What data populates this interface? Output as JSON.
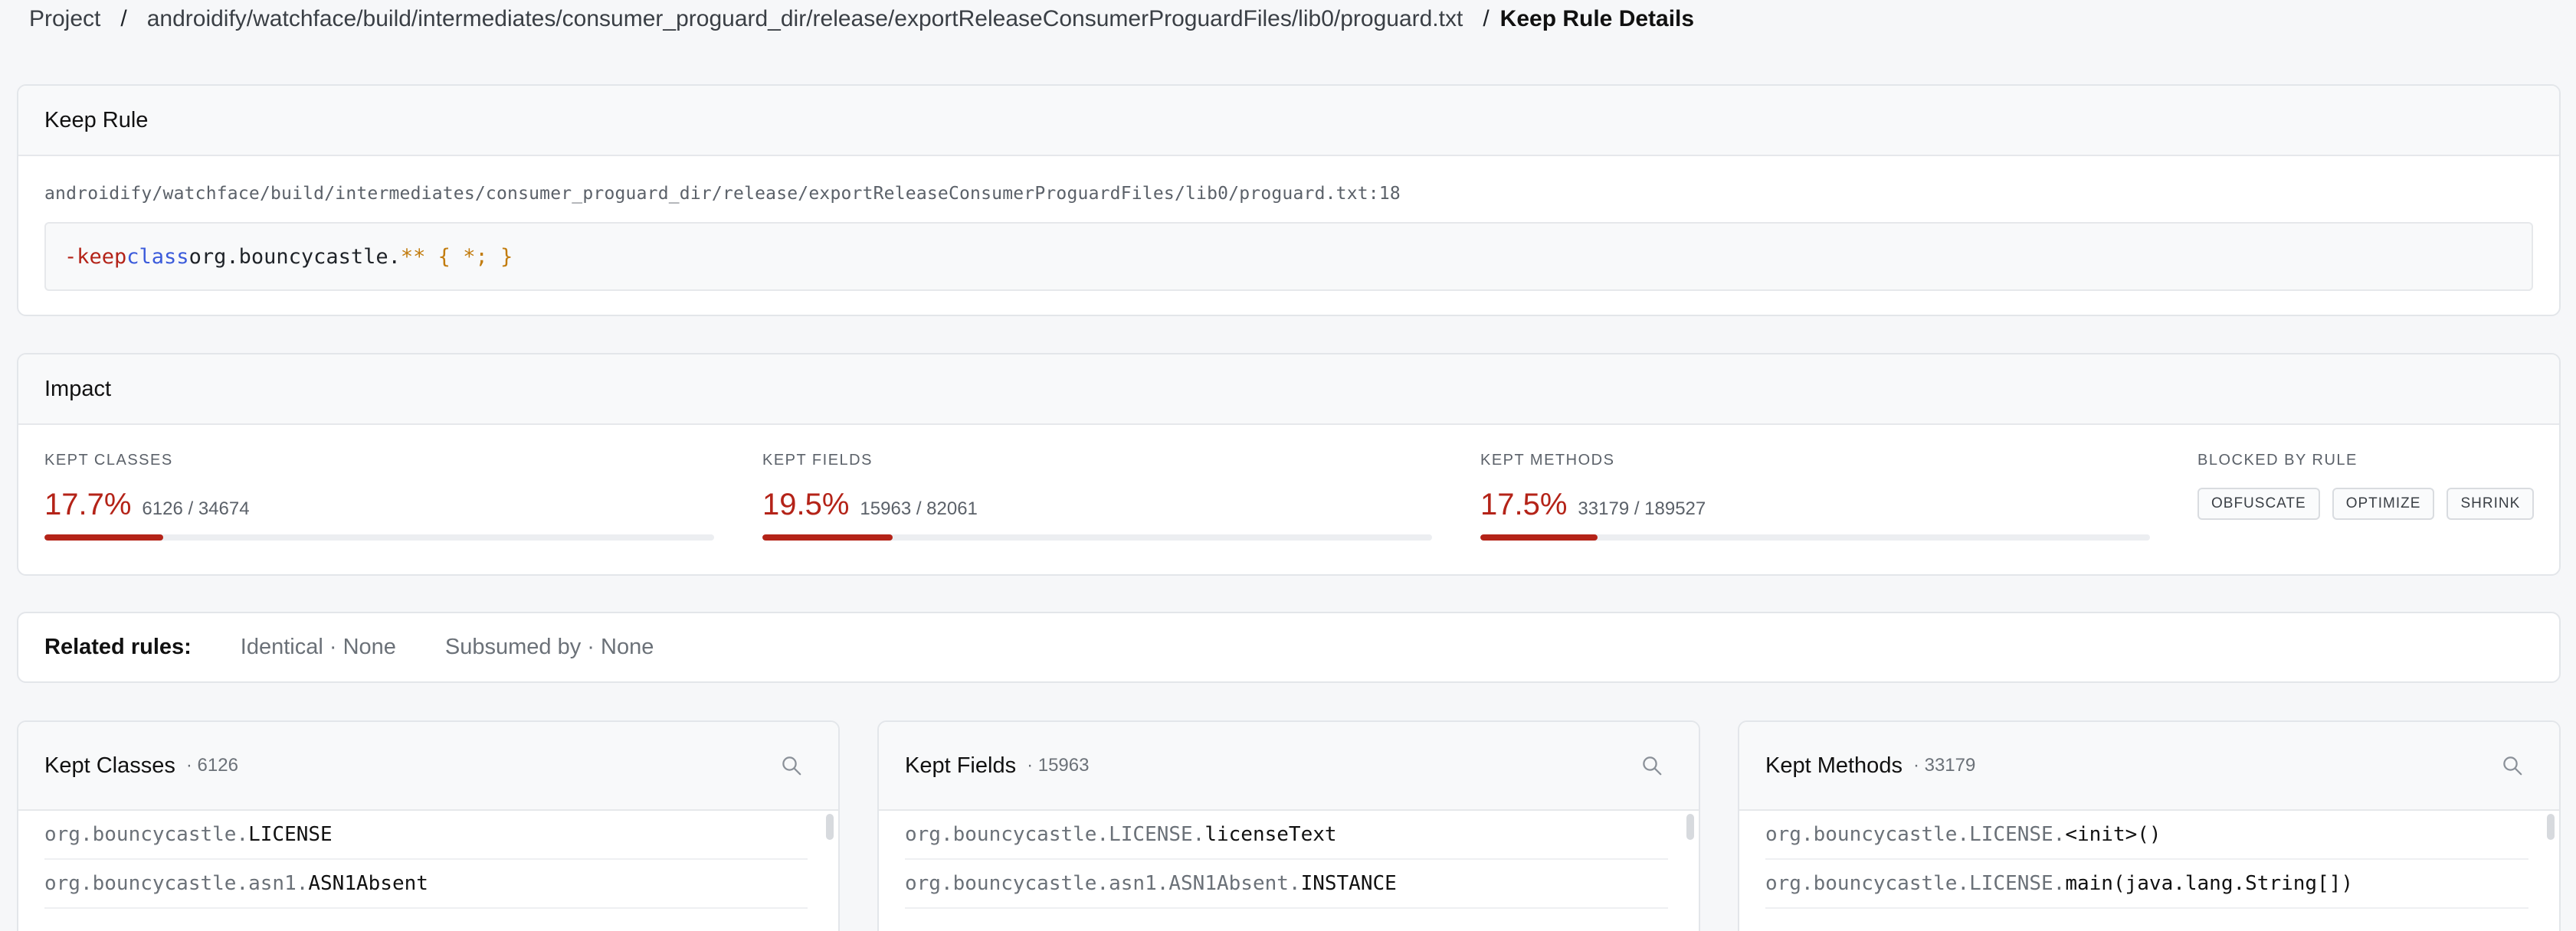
{
  "breadcrumb": {
    "project": "Project",
    "path": "androidify/watchface/build/intermediates/consumer_proguard_dir/release/exportReleaseConsumerProguardFiles/lib0/proguard.txt",
    "current": "Keep Rule Details",
    "separator": "/"
  },
  "keep_rule": {
    "title": "Keep Rule",
    "location": "androidify/watchface/build/intermediates/consumer_proguard_dir/release/exportReleaseConsumerProguardFiles/lib0/proguard.txt:18",
    "code": {
      "directive": "-keep",
      "keyword": "class",
      "name": "org.bouncycastle.",
      "wildcard": "**",
      "body": " { *; }"
    }
  },
  "impact": {
    "title": "Impact",
    "metrics": [
      {
        "label": "Kept Classes",
        "percent": "17.7%",
        "count": "6126 / 34674",
        "fraction": 0.177
      },
      {
        "label": "Kept Fields",
        "percent": "19.5%",
        "count": "15963 / 82061",
        "fraction": 0.195
      },
      {
        "label": "Kept Methods",
        "percent": "17.5%",
        "count": "33179 / 189527",
        "fraction": 0.175
      }
    ],
    "blocked": {
      "label": "Blocked by rule",
      "badges": [
        "OBFUSCATE",
        "OPTIMIZE",
        "SHRINK"
      ]
    }
  },
  "related": {
    "title": "Related rules:",
    "identical": "Identical · None",
    "subsumed": "Subsumed by · None"
  },
  "panels": [
    {
      "title": "Kept Classes",
      "count": "· 6126",
      "rows": [
        {
          "pkg": "org.bouncycastle.",
          "name": "LICENSE"
        },
        {
          "pkg": "org.bouncycastle.asn1.",
          "name": "ASN1Absent"
        }
      ]
    },
    {
      "title": "Kept Fields",
      "count": "· 15963",
      "rows": [
        {
          "pkg": "org.bouncycastle.LICENSE.",
          "name": "licenseText"
        },
        {
          "pkg": "org.bouncycastle.asn1.ASN1Absent.",
          "name": "INSTANCE"
        }
      ]
    },
    {
      "title": "Kept Methods",
      "count": "· 33179",
      "rows": [
        {
          "pkg": "org.bouncycastle.LICENSE.",
          "name": "<init>()"
        },
        {
          "pkg": "org.bouncycastle.LICENSE.",
          "name": "main(java.lang.String[])"
        }
      ]
    }
  ],
  "icons": {
    "search": "search-icon"
  },
  "colors": {
    "accent": "#b42318",
    "keyword_blue": "#3b5bdb",
    "wildcard": "#c27c0e"
  }
}
